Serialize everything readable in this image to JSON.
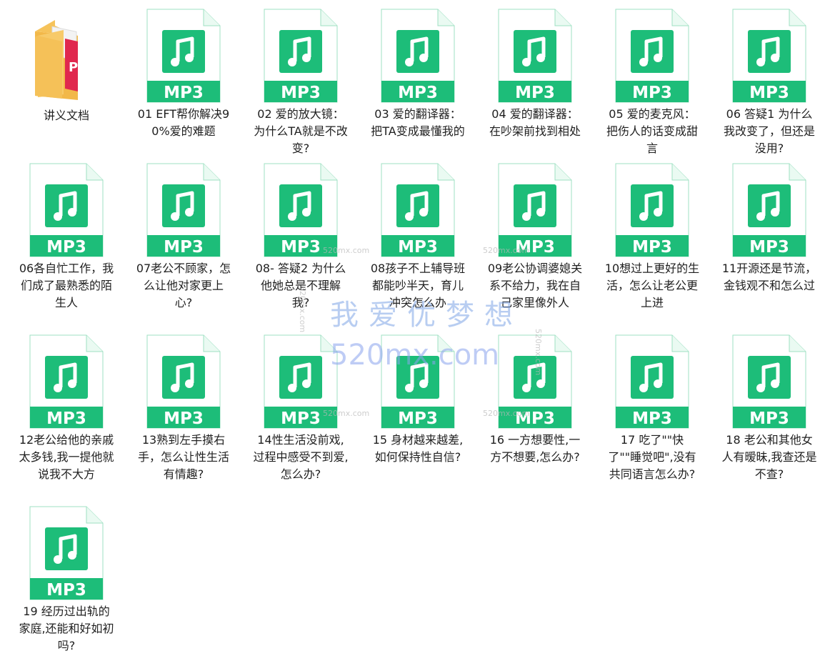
{
  "file_type_label": "MP3",
  "colors": {
    "mp3_green": "#1dbd79",
    "folder_yellow": "#f6c35a",
    "doc_red": "#e0284e"
  },
  "watermark": {
    "text_cn": "我爱优梦想",
    "text_en": "520mx.com",
    "small": "520mx.com"
  },
  "folder": {
    "name": "讲义文档",
    "icon": "folder-with-pdf-icon"
  },
  "files": [
    {
      "name": "01 EFT帮你解决90%爱的难题"
    },
    {
      "name": "02 爱的放大镜：为什么TA就是不改变?"
    },
    {
      "name": "03 爱的翻译器：把TA变成最懂我的"
    },
    {
      "name": "04 爱的翻译器：在吵架前找到相处"
    },
    {
      "name": "05 爱的麦克风：把伤人的话变成甜言"
    },
    {
      "name": "06 答疑1 为什么我改变了，但还是没用?"
    },
    {
      "name": "06各自忙工作，我们成了最熟悉的陌生人"
    },
    {
      "name": "07老公不顾家，怎么让他对家更上心?"
    },
    {
      "name": "08- 答疑2 为什么他她总是不理解我?"
    },
    {
      "name": "08孩子不上辅导班都能吵半天，育儿冲突怎么办"
    },
    {
      "name": "09老公协调婆媳关系不给力，我在自己家里像外人"
    },
    {
      "name": "10想过上更好的生活，怎么让老公更上进"
    },
    {
      "name": "11开源还是节流，金钱观不和怎么过"
    },
    {
      "name": "12老公给他的亲戚太多钱,我一提他就说我不大方"
    },
    {
      "name": "13熟到左手摸右手，怎么让性生活有情趣?"
    },
    {
      "name": "14性生活没前戏,过程中感受不到爱,怎么办?"
    },
    {
      "name": "15 身材越来越差,如何保持性自信?"
    },
    {
      "name": "16 一方想要性,一方不想要,怎么办?"
    },
    {
      "name": "17 吃了\"\"快了\"\"睡觉吧\",没有共同语言怎么办?"
    },
    {
      "name": "18 老公和其他女人有暧昧,我查还是不查?"
    },
    {
      "name": "19 经历过出轨的家庭,还能和好如初吗?"
    }
  ]
}
